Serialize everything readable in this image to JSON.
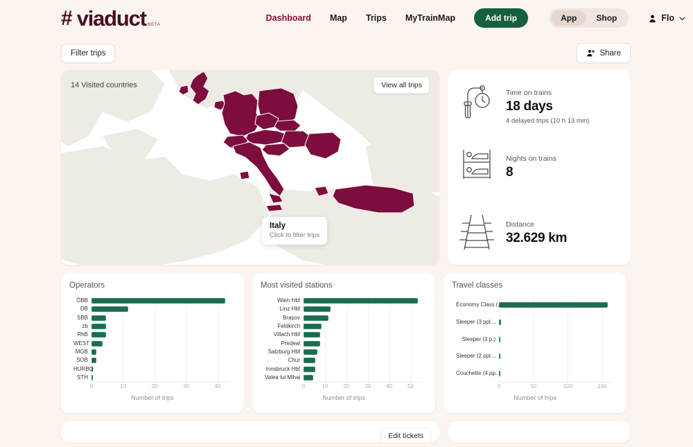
{
  "header": {
    "logo": {
      "hash": "#",
      "word": "viaduct",
      "beta": "BETA"
    },
    "nav": [
      {
        "label": "Dashboard",
        "active": true
      },
      {
        "label": "Map",
        "active": false
      },
      {
        "label": "Trips",
        "active": false
      },
      {
        "label": "MyTrainMap",
        "active": false
      }
    ],
    "add_trip_label": "Add trip",
    "segmented": [
      {
        "label": "App",
        "active": true
      },
      {
        "label": "Shop",
        "active": false
      }
    ],
    "user_name": "Flo",
    "accent_maroon": "#8a0f3c",
    "accent_green": "#14603f"
  },
  "toolbar": {
    "filter_label": "Filter trips",
    "share_label": "Share"
  },
  "map_card": {
    "visited_countries": "14 Visited countries",
    "view_all_label": "View all trips",
    "tooltip": {
      "country": "Italy",
      "hint": "Click to filter trips"
    },
    "land_color": "#eeeae4",
    "visited_color": "#7c0d3c"
  },
  "stats": [
    {
      "icon": "station-clock-icon",
      "label": "Time on trains",
      "value": "18 days",
      "sub": "4 delayed trips (10 h 13 min)"
    },
    {
      "icon": "bunk-bed-icon",
      "label": "Nights on trains",
      "value": "8",
      "sub": ""
    },
    {
      "icon": "railway-track-icon",
      "label": "Distance",
      "value": "32.629 km",
      "sub": ""
    }
  ],
  "chart_data": [
    {
      "type": "bar",
      "orientation": "horizontal",
      "title": "Operators",
      "categories": [
        "ÖBB",
        "DB",
        "SBB",
        "zb",
        "RhB",
        "WEST",
        "MGB",
        "SOB",
        "HURBO",
        "STH"
      ],
      "values": [
        42.5,
        11.7,
        4.6,
        4.6,
        4.6,
        3.6,
        1.5,
        1.6,
        0.5,
        0.5
      ],
      "xlabel": "Number of trips",
      "ylabel": "",
      "xlim": [
        0,
        44
      ],
      "xticks": [
        0,
        10,
        20,
        30,
        40
      ],
      "grid": true,
      "bar_color": "#1e6b4e"
    },
    {
      "type": "bar",
      "orientation": "horizontal",
      "title": "Most visited stations",
      "categories": [
        "Wien Hbf",
        "Linz Hbf",
        "Braşov",
        "Feldkirch",
        "Villach Hbf",
        "Predeal",
        "Salzburg Hbf",
        "Chur",
        "Innsbruck Hbf",
        "Valea lui Mihai"
      ],
      "values": [
        53.5,
        12.6,
        11.6,
        8.5,
        7.8,
        7.8,
        6.6,
        5.6,
        5.6,
        4.6
      ],
      "xlabel": "Number of trips",
      "ylabel": "",
      "xlim": [
        0,
        55
      ],
      "xticks": [
        0,
        10,
        20,
        30,
        40,
        50
      ],
      "grid": true,
      "bar_color": "#1e6b4e"
    },
    {
      "type": "bar",
      "orientation": "horizontal",
      "title": "Travel classes",
      "categories": [
        "Economy Class (...",
        "Sleeper (3 ppl....",
        "Sleeper (1 p.)",
        "Sleeper (2 ppl....",
        "Couchette (4 pp..."
      ],
      "values": [
        158,
        3,
        1,
        0.6,
        0.6
      ],
      "xlabel": "Number of trips",
      "ylabel": "",
      "xlim": [
        0,
        165
      ],
      "xticks": [
        0,
        50,
        100,
        150
      ],
      "grid": true,
      "bar_color": "#1e6b4e"
    }
  ],
  "bottom": {
    "edit_tickets_label": "Edit tickets"
  }
}
